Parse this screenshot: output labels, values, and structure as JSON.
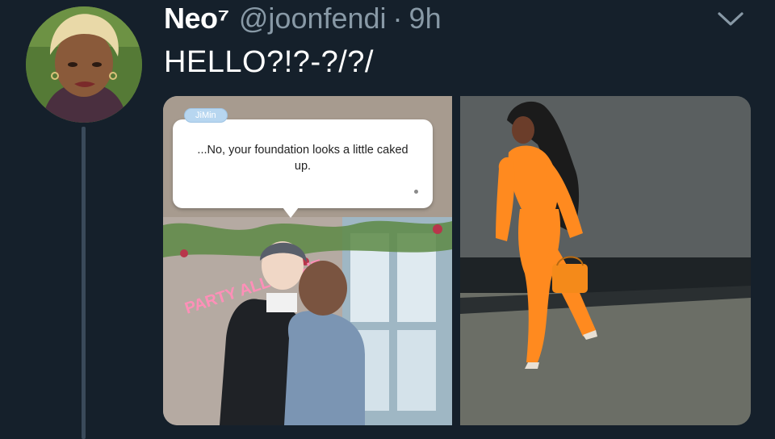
{
  "tweet": {
    "display_name": "Neo⁷",
    "handle": "@joonfendi",
    "separator": "·",
    "time": "9h",
    "text": "HELLO?!?-?/?/"
  },
  "media": {
    "left_image": {
      "speaker_tag": "JiMin",
      "dialogue": "...No, your foundation looks a little caked up.",
      "neon_sign": "PARTY ALL NIGHT"
    },
    "right_image": {}
  },
  "icons": {
    "menu": "chevron-down-icon"
  },
  "colors": {
    "background": "#15202b",
    "secondary_text": "#8899a6",
    "primary_text": "#ffffff",
    "thread_line": "#3a4a5a"
  }
}
